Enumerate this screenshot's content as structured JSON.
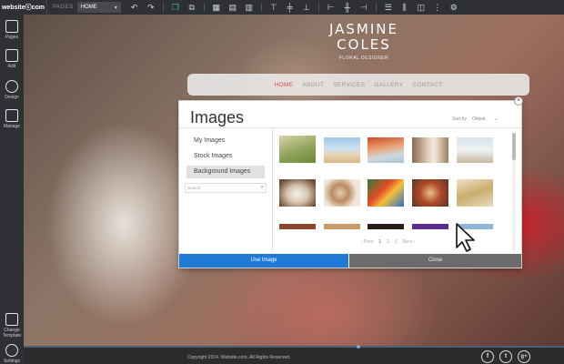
{
  "toolbar": {
    "logo": "websiteⓒcom",
    "pages_label": "PAGES",
    "page_select": "HOME"
  },
  "sidebar": {
    "items": [
      {
        "label": "Pages"
      },
      {
        "label": "Add"
      },
      {
        "label": "Design"
      },
      {
        "label": "Manage"
      },
      {
        "label": "Change Template"
      },
      {
        "label": "Settings"
      }
    ]
  },
  "site": {
    "title_line1": "JASMINE",
    "title_line2": "COLES",
    "subtitle": "FLORAL DESIGNER",
    "nav": [
      "HOME",
      "ABOUT",
      "SERVICES",
      "GALLERY",
      "CONTACT"
    ],
    "nav_active": "HOME"
  },
  "modal": {
    "title": "Images",
    "sort_label": "Sort by",
    "sort_value": "Oldest",
    "categories": [
      "My Images",
      "Stock Images",
      "Background Images"
    ],
    "selected_category": "Background Images",
    "search_placeholder": "Search",
    "pager": {
      "prev": "‹ Prev",
      "pages": [
        "1",
        "2",
        "3"
      ],
      "current": "1",
      "next": "Next ›"
    },
    "use_button": "Use Image",
    "close_button": "Close",
    "thumbnails": [
      {
        "name": "green-field"
      },
      {
        "name": "beach-umbrella"
      },
      {
        "name": "beach-cabana"
      },
      {
        "name": "wedding-couple"
      },
      {
        "name": "wedding-beach"
      },
      {
        "name": "coffee-cup"
      },
      {
        "name": "coffee-latte"
      },
      {
        "name": "parrot"
      },
      {
        "name": "dessert-plate"
      },
      {
        "name": "wheat"
      },
      {
        "name": "brown-row"
      },
      {
        "name": "food-row"
      },
      {
        "name": "dark-row"
      },
      {
        "name": "purple-row"
      },
      {
        "name": "blue-row"
      }
    ]
  },
  "footer": {
    "copyright": "Copyright 2014. Website.com. All Rights Reserved.",
    "social": [
      "f",
      "t",
      "g+"
    ]
  },
  "colors": {
    "accent": "#1f7ad6",
    "nav_active": "#d64b4b",
    "toolbar_bg": "#2f3033",
    "close_button": "#6b6b6b"
  }
}
